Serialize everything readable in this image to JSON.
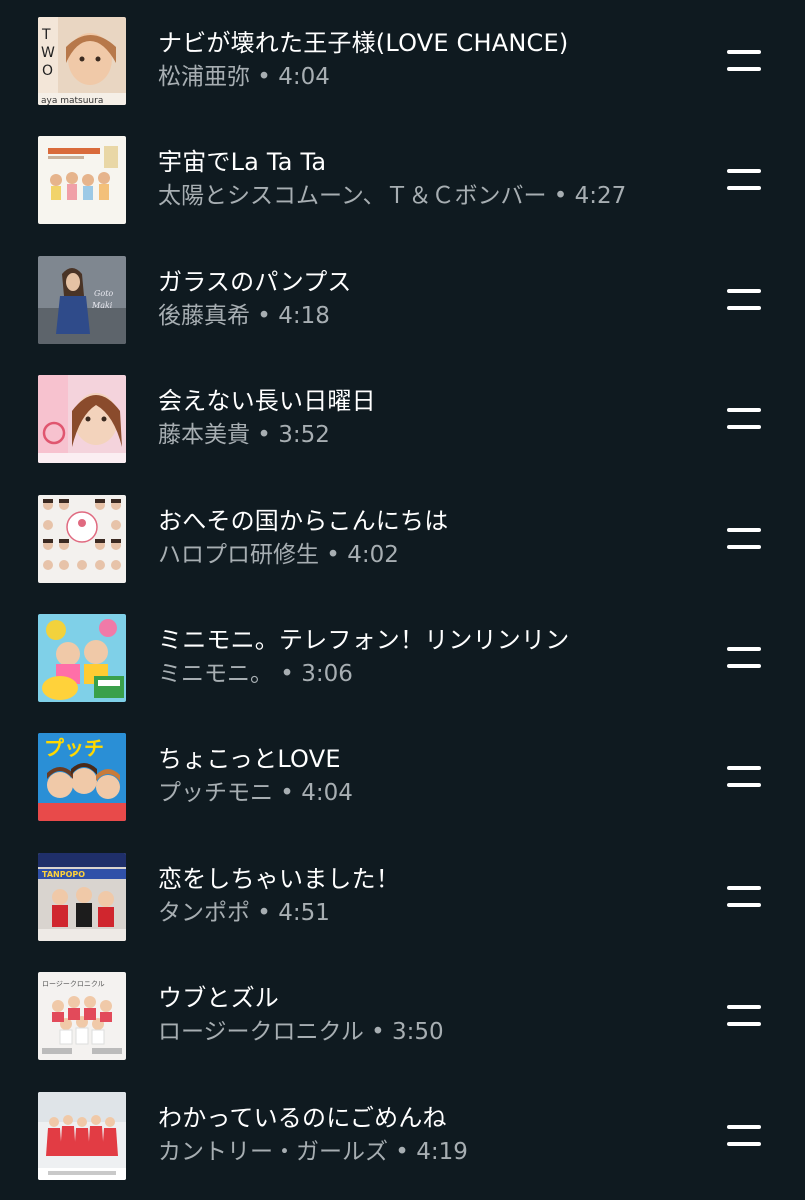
{
  "queue": {
    "tracks": [
      {
        "title": "ナビが壊れた王子様(LOVE CHANCE)",
        "subtitle": "松浦亜弥 • 4:04",
        "artist": "松浦亜弥",
        "duration": "4:04",
        "cover_text": "aya matsuura"
      },
      {
        "title": "宇宙でLa Ta Ta",
        "subtitle": "太陽とシスコムーン、Ｔ＆Ｃボンバー • 4:27",
        "artist": "太陽とシスコムーン、Ｔ＆Ｃボンバー",
        "duration": "4:27"
      },
      {
        "title": "ガラスのパンプス",
        "subtitle": "後藤真希 • 4:18",
        "artist": "後藤真希",
        "duration": "4:18"
      },
      {
        "title": "会えない長い日曜日",
        "subtitle": "藤本美貴 • 3:52",
        "artist": "藤本美貴",
        "duration": "3:52"
      },
      {
        "title": "おへその国からこんにちは",
        "subtitle": "ハロプロ研修生 • 4:02",
        "artist": "ハロプロ研修生",
        "duration": "4:02"
      },
      {
        "title": "ミニモニ。テレフォン！リンリンリン",
        "subtitle": "ミニモニ。 • 3:06",
        "artist": "ミニモニ。",
        "duration": "3:06"
      },
      {
        "title": "ちょこっとLOVE",
        "subtitle": "プッチモニ • 4:04",
        "artist": "プッチモニ",
        "duration": "4:04"
      },
      {
        "title": "恋をしちゃいました！",
        "subtitle": "タンポポ • 4:51",
        "artist": "タンポポ",
        "duration": "4:51",
        "cover_text": "TANPOPO"
      },
      {
        "title": "ウブとズル",
        "subtitle": "ロージークロニクル • 3:50",
        "artist": "ロージークロニクル",
        "duration": "3:50",
        "cover_text": "ロージークロニクル"
      },
      {
        "title": "わかっているのにごめんね",
        "subtitle": "カントリー・ガールズ • 4:19",
        "artist": "カントリー・ガールズ",
        "duration": "4:19"
      }
    ]
  },
  "colors": {
    "background": "#0f1a20",
    "title_text": "#ffffff",
    "subtitle_text": "#a7aeb2",
    "handle": "#ffffff"
  },
  "icons": {
    "drag_handle": "drag-handle-icon"
  }
}
